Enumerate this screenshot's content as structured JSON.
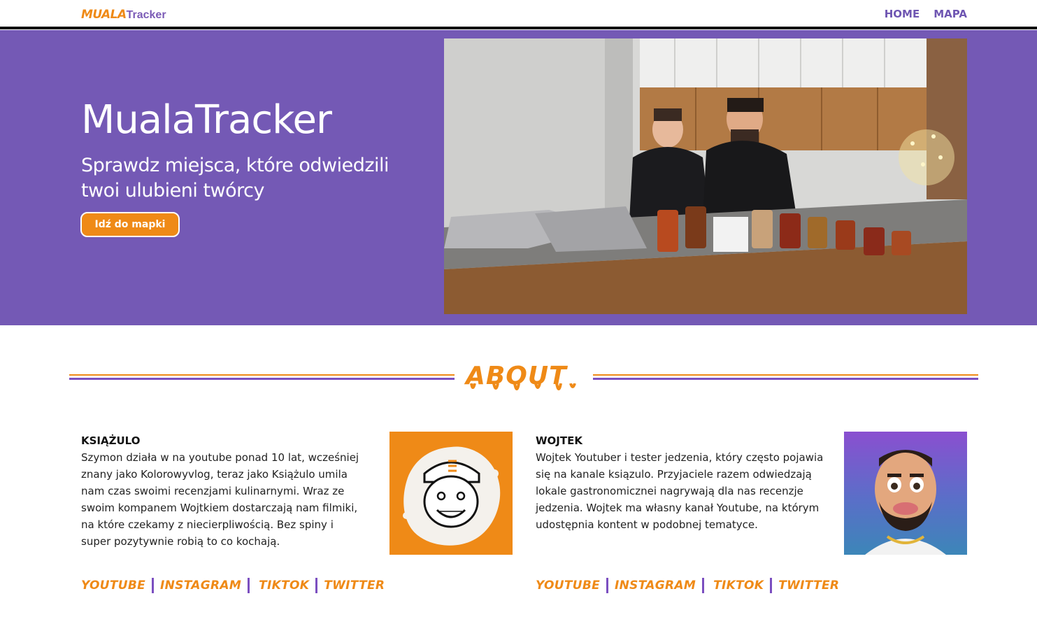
{
  "nav": {
    "logo_part1": "MUALA",
    "logo_part2": "Tracker",
    "links": [
      "HOME",
      "MAPA"
    ]
  },
  "hero": {
    "title": "MualaTracker",
    "subtitle": "Sprawdz miejsca, które odwiedzili twoi ulubieni twórcy",
    "button_label": "Idź do mapki"
  },
  "about": {
    "heading": "ABOUT"
  },
  "profiles": [
    {
      "name": "KSIĄŻULO",
      "description": "Szymon działa w na youtube ponad 10 lat, wcześniej znany jako Kolorowyvlog, teraz jako Książulo umila nam czas swoimi recenzjami kulinarnymi. Wraz ze swoim kompanem Wojtkiem dostarczają nam filmiki, na które czekamy z niecierpliwością. Bez spiny i super pozytywnie robią to co kochają.",
      "socials": [
        "YOUTUBE",
        "INSTAGRAM",
        "TIKTOK",
        "TWITTER"
      ]
    },
    {
      "name": "WOJTEK",
      "description": "Wojtek Youtuber i tester jedzenia, który często pojawia się na kanale ksiązulo. Przyjaciele razem odwiedzają lokale gastronomicznei nagrywają dla nas recenzje jedzenia. Wojtek ma własny kanał Youtube, na którym udostępnia kontent w podobnej tematyce.",
      "socials": [
        "YOUTUBE",
        "INSTAGRAM",
        "TIKTOK",
        "TWITTER"
      ]
    }
  ],
  "colors": {
    "accent_orange": "#ef8a17",
    "brand_purple": "#7459b5",
    "line_purple": "#7b4fc0"
  }
}
